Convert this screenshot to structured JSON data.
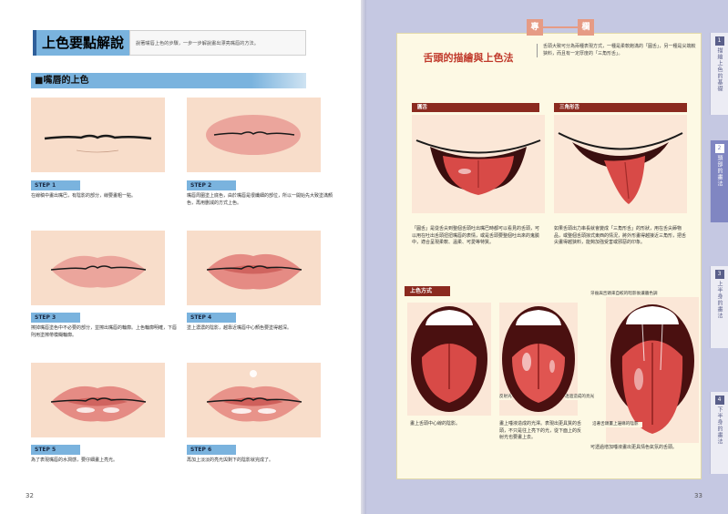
{
  "left": {
    "title": "上色要點解說",
    "title_desc": "說著嘴唇上色的步驟，一步一步解說畫出漂亮嘴唇的方法。",
    "section": "■嘴唇的上色",
    "steps": [
      {
        "label": "STEP 1",
        "text": "在線稿中畫出嘴巴，有陰影的部分，線要畫粗一點。"
      },
      {
        "label": "STEP 2",
        "text": "嘴唇周圍塗上底色，由於嘴唇是很纖細的部位，所以一開始先大致塗滿顏色，再用删減的方式上色。"
      },
      {
        "label": "STEP 3",
        "text": "擦掉嘴唇塗色中不必要的部分，並擦出嘴唇的輪廓。上色輪廓明確，下唇則用塗擦帶模糊輪廓。"
      },
      {
        "label": "STEP 4",
        "text": "塗上濃濃的陰影，越靠近嘴唇中心顏色要塗得越深。"
      },
      {
        "label": "STEP 5",
        "text": "為了表現嘴唇的水潤感，要仔細畫上亮光。"
      },
      {
        "label": "STEP 6",
        "text": "再加上淡淡的亮光與剩下的陰影就完成了。"
      }
    ],
    "page_num": "32"
  },
  "right": {
    "badge": [
      "專",
      "欄"
    ],
    "column_title": "舌頭的描繪與上色法",
    "column_desc": "舌頭大致可分為兩種表現方式，一種是柔軟飽滿的「圓舌」，另一種是尖端較狹料，而且有一定厚度的「三角形舌」。",
    "round_label": "圓舌",
    "triangle_label": "三角形舌",
    "round_text": "「圓舌」是從舌尖到整個舌頭吐出嘴巴時都可以看見的舌頭，可以用在吐出舌頭扭扭嘴唇的表情，或是舌頭要整個吐出來的鬼臉中，適合呈現柔軟、溫柔、可愛等特質。",
    "triangle_text": "如果舌頭出力串長就會變成「三角形舌」的形狀，用在舌尖舔物品，或整個舌頭掠式東西的情況，將外形畫得越接近三角形，把舌尖畫得越狹料，能夠加強受害或邪惡的印象。",
    "coloring_label": "上色方式",
    "annot_top": "牙齒與舌頭來自較的暗影後讓牆色調",
    "annot_reflect": "反射光",
    "annot_gap": "透過造成的亮光",
    "annot_shadow": "沿著舌頭畫上邊緣的陰影",
    "caption1": "畫上舌頭中心線的陰影。",
    "caption2": "畫上唾液造成的光澤。表現出更具質的舌頭，不只是往上亮下的光，從下面上的反射光也要畫上去。",
    "caption3": "可透過增加唾液畫出更具情色氣氛的舌頭。",
    "page_num": "33",
    "tabs": [
      {
        "num": "1",
        "label": "描繪上色的基礎"
      },
      {
        "num": "2",
        "label": "頭部的畫法"
      },
      {
        "num": "3",
        "label": "上半身的畫法"
      },
      {
        "num": "4",
        "label": "下半身的畫法"
      }
    ]
  }
}
